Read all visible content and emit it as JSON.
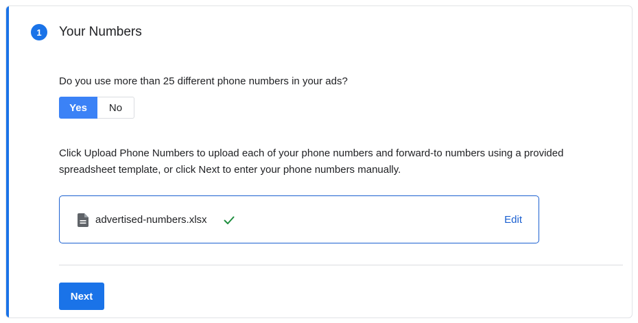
{
  "step": {
    "number": "1",
    "title": "Your Numbers"
  },
  "question": {
    "text": "Do you use more than 25 different phone numbers in your ads?",
    "options": {
      "yes_label": "Yes",
      "no_label": "No"
    },
    "selected": "Yes"
  },
  "instructions": "Click Upload Phone Numbers to upload each of your phone numbers and forward-to numbers using a provided spreadsheet template, or click Next to enter your phone numbers manually.",
  "upload": {
    "file_icon": "document-icon",
    "file_name": "advertised-numbers.xlsx",
    "status_icon": "checkmark-icon",
    "edit_label": "Edit"
  },
  "footer": {
    "next_label": "Next"
  },
  "colors": {
    "accent": "#1a73e8",
    "toggle_selected": "#3b82f6",
    "success": "#1e8e3e",
    "link": "#1a5fd0"
  }
}
